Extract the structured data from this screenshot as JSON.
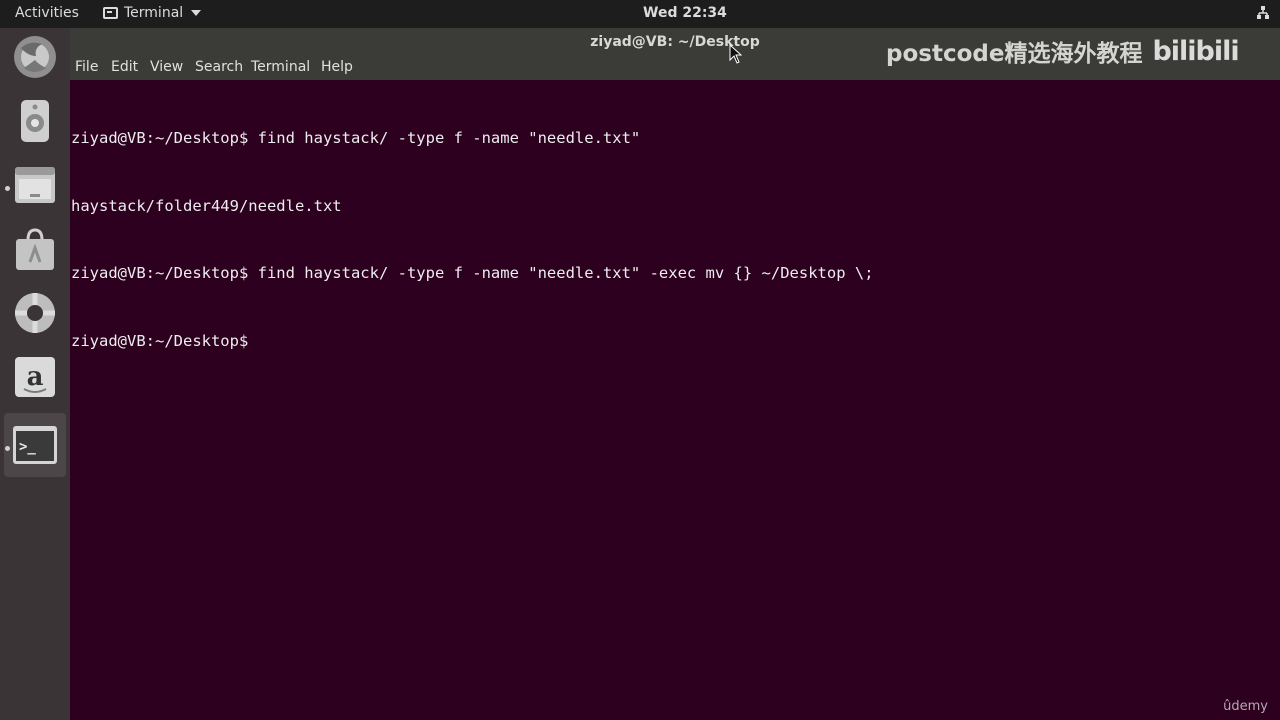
{
  "topbar": {
    "activities": "Activities",
    "app_name": "Terminal",
    "clock": "Wed 22:34",
    "tray_icon": "network-icon"
  },
  "dock": {
    "items": [
      {
        "name": "firefox",
        "icon": "firefox-icon"
      },
      {
        "name": "rhythmbox",
        "icon": "speaker-icon"
      },
      {
        "name": "files",
        "icon": "file-cabinet-icon"
      },
      {
        "name": "software",
        "icon": "shopping-bag-icon"
      },
      {
        "name": "help",
        "icon": "lifebuoy-icon"
      },
      {
        "name": "amazon",
        "icon": "amazon-icon",
        "label": "a"
      },
      {
        "name": "terminal",
        "icon": "terminal-icon",
        "label": ">_"
      }
    ]
  },
  "window": {
    "title": "ziyad@VB: ~/Desktop",
    "menu": {
      "file": "File",
      "edit": "Edit",
      "view": "View",
      "search": "Search",
      "terminal": "Terminal",
      "help": "Help"
    },
    "lines": [
      "ziyad@VB:~/Desktop$ find haystack/ -type f -name \"needle.txt\"",
      "haystack/folder449/needle.txt",
      "ziyad@VB:~/Desktop$ find haystack/ -type f -name \"needle.txt\" -exec mv {} ~/Desktop \\;",
      "ziyad@VB:~/Desktop$ "
    ]
  },
  "overlay": {
    "watermark_text": "postcode精选海外教程",
    "watermark_logo": "bilibili",
    "udemy": "ûdemy"
  },
  "colors": {
    "terminal_bg": "#2c001e",
    "terminal_fg": "#ededed",
    "topbar_bg": "#1d1d1d",
    "dock_bg": "#3a3436",
    "titlebar_bg": "#3b3b37"
  }
}
